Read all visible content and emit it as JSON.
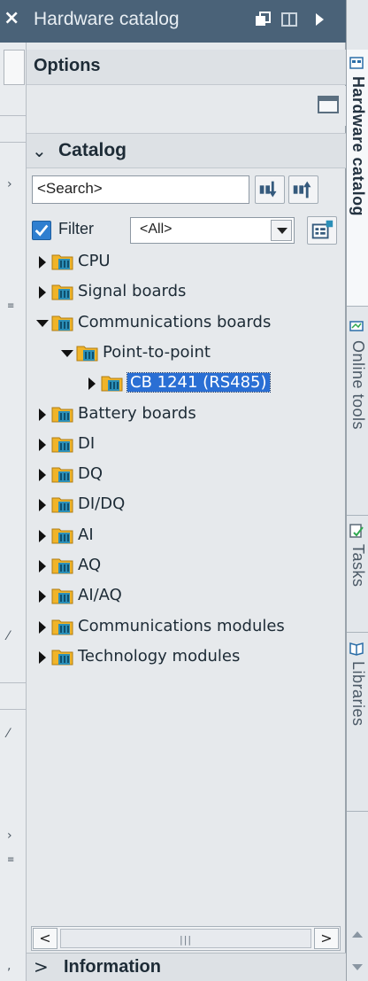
{
  "panel": {
    "title": "Hardware catalog",
    "options_label": "Options",
    "catalog_label": "Catalog",
    "search_value": "<Search>",
    "filter_label": "Filter",
    "filter_checked": true,
    "filter_value": "<All>",
    "information_label": "Information"
  },
  "tree": [
    {
      "label": "CPU",
      "level": 0,
      "expanded": false,
      "selected": false
    },
    {
      "label": "Signal boards",
      "level": 0,
      "expanded": false,
      "selected": false
    },
    {
      "label": "Communications boards",
      "level": 0,
      "expanded": true,
      "selected": false
    },
    {
      "label": "Point-to-point",
      "level": 1,
      "expanded": true,
      "selected": false
    },
    {
      "label": "CB 1241 (RS485)",
      "level": 2,
      "expanded": false,
      "selected": true
    },
    {
      "label": "Battery boards",
      "level": 0,
      "expanded": false,
      "selected": false
    },
    {
      "label": "DI",
      "level": 0,
      "expanded": false,
      "selected": false
    },
    {
      "label": "DQ",
      "level": 0,
      "expanded": false,
      "selected": false
    },
    {
      "label": "DI/DQ",
      "level": 0,
      "expanded": false,
      "selected": false
    },
    {
      "label": "AI",
      "level": 0,
      "expanded": false,
      "selected": false
    },
    {
      "label": "AQ",
      "level": 0,
      "expanded": false,
      "selected": false
    },
    {
      "label": "AI/AQ",
      "level": 0,
      "expanded": false,
      "selected": false
    },
    {
      "label": "Communications modules",
      "level": 0,
      "expanded": false,
      "selected": false
    },
    {
      "label": "Technology modules",
      "level": 0,
      "expanded": false,
      "selected": false
    }
  ],
  "right_tabs": {
    "hardware_catalog": "Hardware catalog",
    "online_tools": "Online tools",
    "tasks": "Tasks",
    "libraries": "Libraries"
  },
  "colors": {
    "title_bar": "#4a6278",
    "selection": "#2a6fd4",
    "folder": "#f0b429",
    "module": "#2b8fb8"
  },
  "icons": {
    "tree_node": "folder-module-icon",
    "search_down": "search-down-icon",
    "search_up": "search-up-icon",
    "filter_profile": "filter-profile-icon"
  }
}
